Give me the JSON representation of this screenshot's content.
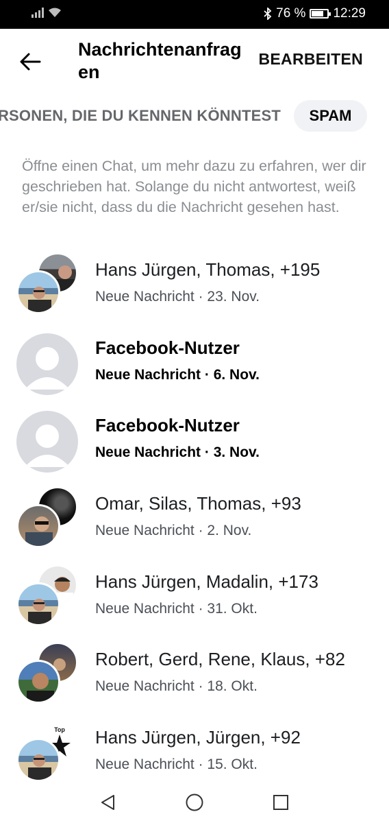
{
  "status_bar": {
    "battery_percent": "76 %",
    "battery_level": 0.76,
    "time": "12:29"
  },
  "header": {
    "title": "Nachrichtenanfragen",
    "edit_label": "BEARBEITEN"
  },
  "tabs": {
    "people_label": "PERSONEN, DIE DU KENNEN KÖNNTEST",
    "spam_label": "SPAM"
  },
  "info_text": "Öffne einen Chat, um mehr dazu zu erfahren, wer dir geschrieben hat. Solange du nicht antwortest, weiß er/sie nicht, dass du die Nachricht gesehen hast.",
  "requests": [
    {
      "name": "Hans Jürgen, Thomas, +195",
      "meta": "Neue Nachricht · 23. Nov.",
      "unread": false,
      "avatar": "group-photo"
    },
    {
      "name": "Facebook-Nutzer",
      "meta": "Neue Nachricht · 6. Nov.",
      "unread": true,
      "avatar": "default-user"
    },
    {
      "name": "Facebook-Nutzer",
      "meta": "Neue Nachricht · 3. Nov.",
      "unread": true,
      "avatar": "default-user"
    },
    {
      "name": "Omar, Silas, Thomas, +93",
      "meta": "Neue Nachricht · 2. Nov.",
      "unread": false,
      "avatar": "group-photo"
    },
    {
      "name": "Hans Jürgen, Madalin, +173",
      "meta": "Neue Nachricht · 31. Okt.",
      "unread": false,
      "avatar": "group-photo"
    },
    {
      "name": "Robert, Gerd, Rene, Klaus, +82",
      "meta": "Neue Nachricht · 18. Okt.",
      "unread": false,
      "avatar": "group-photo"
    },
    {
      "name": "Hans Jürgen, Jürgen, +92",
      "meta": "Neue Nachricht · 15. Okt.",
      "unread": false,
      "avatar": "group-photo"
    }
  ],
  "logo_text": "Top",
  "colors": {
    "spam_pill": "#f0f2f5",
    "muted_text": "#8a8d91"
  }
}
